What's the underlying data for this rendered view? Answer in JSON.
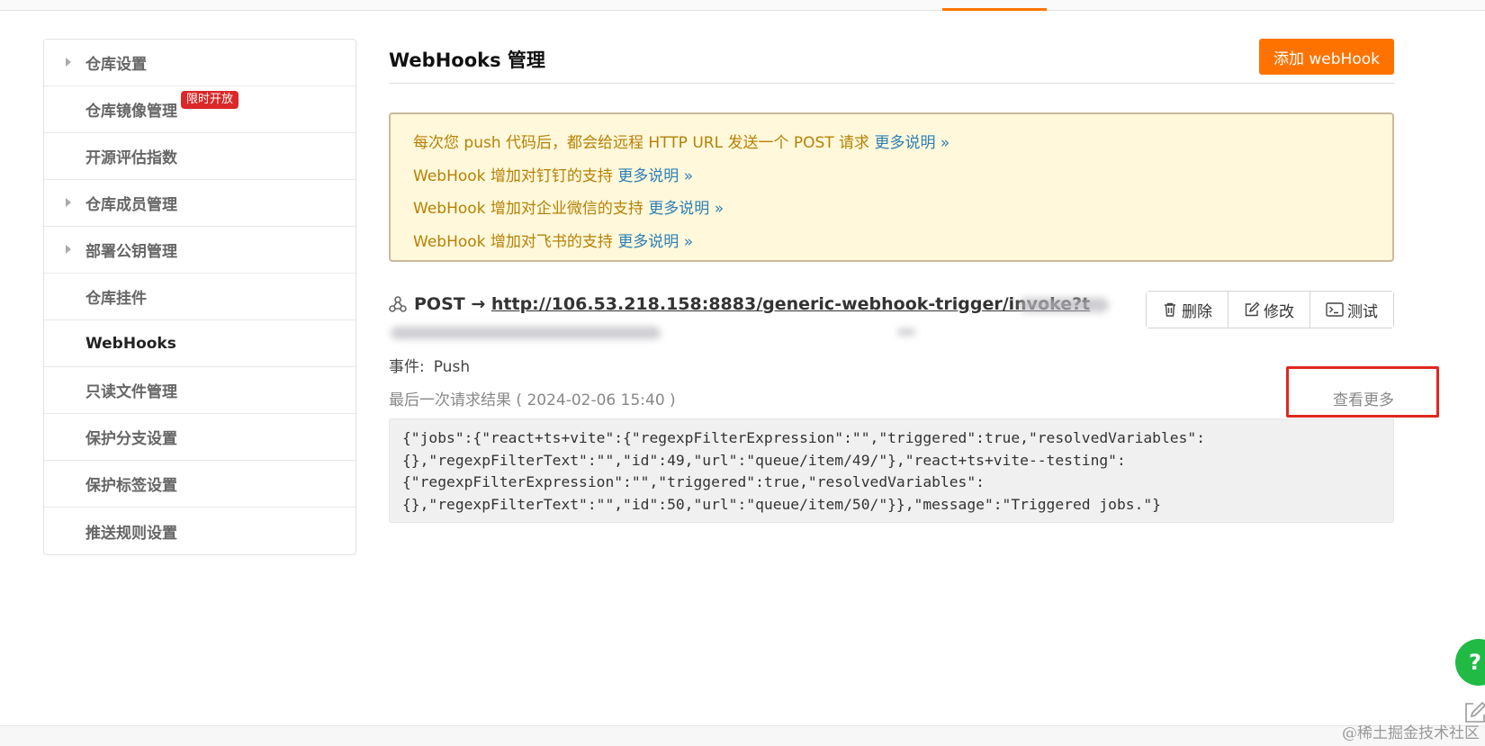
{
  "sidebar": {
    "items": [
      {
        "label": "仓库设置",
        "expandable": true
      },
      {
        "label": "仓库镜像管理",
        "expandable": false,
        "badge": "限时开放"
      },
      {
        "label": "开源评估指数",
        "expandable": false
      },
      {
        "label": "仓库成员管理",
        "expandable": true
      },
      {
        "label": "部署公钥管理",
        "expandable": true
      },
      {
        "label": "仓库挂件",
        "expandable": false
      },
      {
        "label": "WebHooks",
        "expandable": false,
        "active": true
      },
      {
        "label": "只读文件管理",
        "expandable": false
      },
      {
        "label": "保护分支设置",
        "expandable": false
      },
      {
        "label": "保护标签设置",
        "expandable": false
      },
      {
        "label": "推送规则设置",
        "expandable": false
      }
    ]
  },
  "main": {
    "title": "WebHooks 管理",
    "add_button": "添加 webHook",
    "notice": {
      "lines": [
        {
          "text": "每次您 push 代码后，都会给远程 HTTP URL 发送一个 POST 请求",
          "link": "更多说明 »"
        },
        {
          "text": "WebHook 增加对钉钉的支持",
          "link": "更多说明 »"
        },
        {
          "text": "WebHook 增加对企业微信的支持",
          "link": "更多说明 »"
        },
        {
          "text": "WebHook 增加对飞书的支持",
          "link": "更多说明 »"
        }
      ]
    },
    "hook": {
      "method": "POST →",
      "url": "http://106.53.218.158:8883/generic-webhook-trigger/invoke?t",
      "actions": {
        "delete": "删除",
        "edit": "修改",
        "test": "测试"
      },
      "event_label": "事件:",
      "event_value": "Push",
      "last_result_label": "最后一次请求结果 ( 2024-02-06 15:40 )",
      "view_more": "查看更多",
      "response": "{\"jobs\":{\"react+ts+vite\":{\"regexpFilterExpression\":\"\",\"triggered\":true,\"resolvedVariables\":\n{},\"regexpFilterText\":\"\",\"id\":49,\"url\":\"queue/item/49/\"},\"react+ts+vite--testing\":\n{\"regexpFilterExpression\":\"\",\"triggered\":true,\"resolvedVariables\":\n{},\"regexpFilterText\":\"\",\"id\":50,\"url\":\"queue/item/50/\"}},\"message\":\"Triggered jobs.\"}"
    }
  },
  "floating": {
    "help": "?"
  },
  "watermark": "@稀土掘金技术社区",
  "colors": {
    "accent": "#fe7300",
    "notice_bg": "#fff8db",
    "notice_text": "#b58105",
    "link": "#2d7fb5",
    "badge": "#db2828",
    "help": "#21ba45",
    "highlight": "#e0281e"
  }
}
